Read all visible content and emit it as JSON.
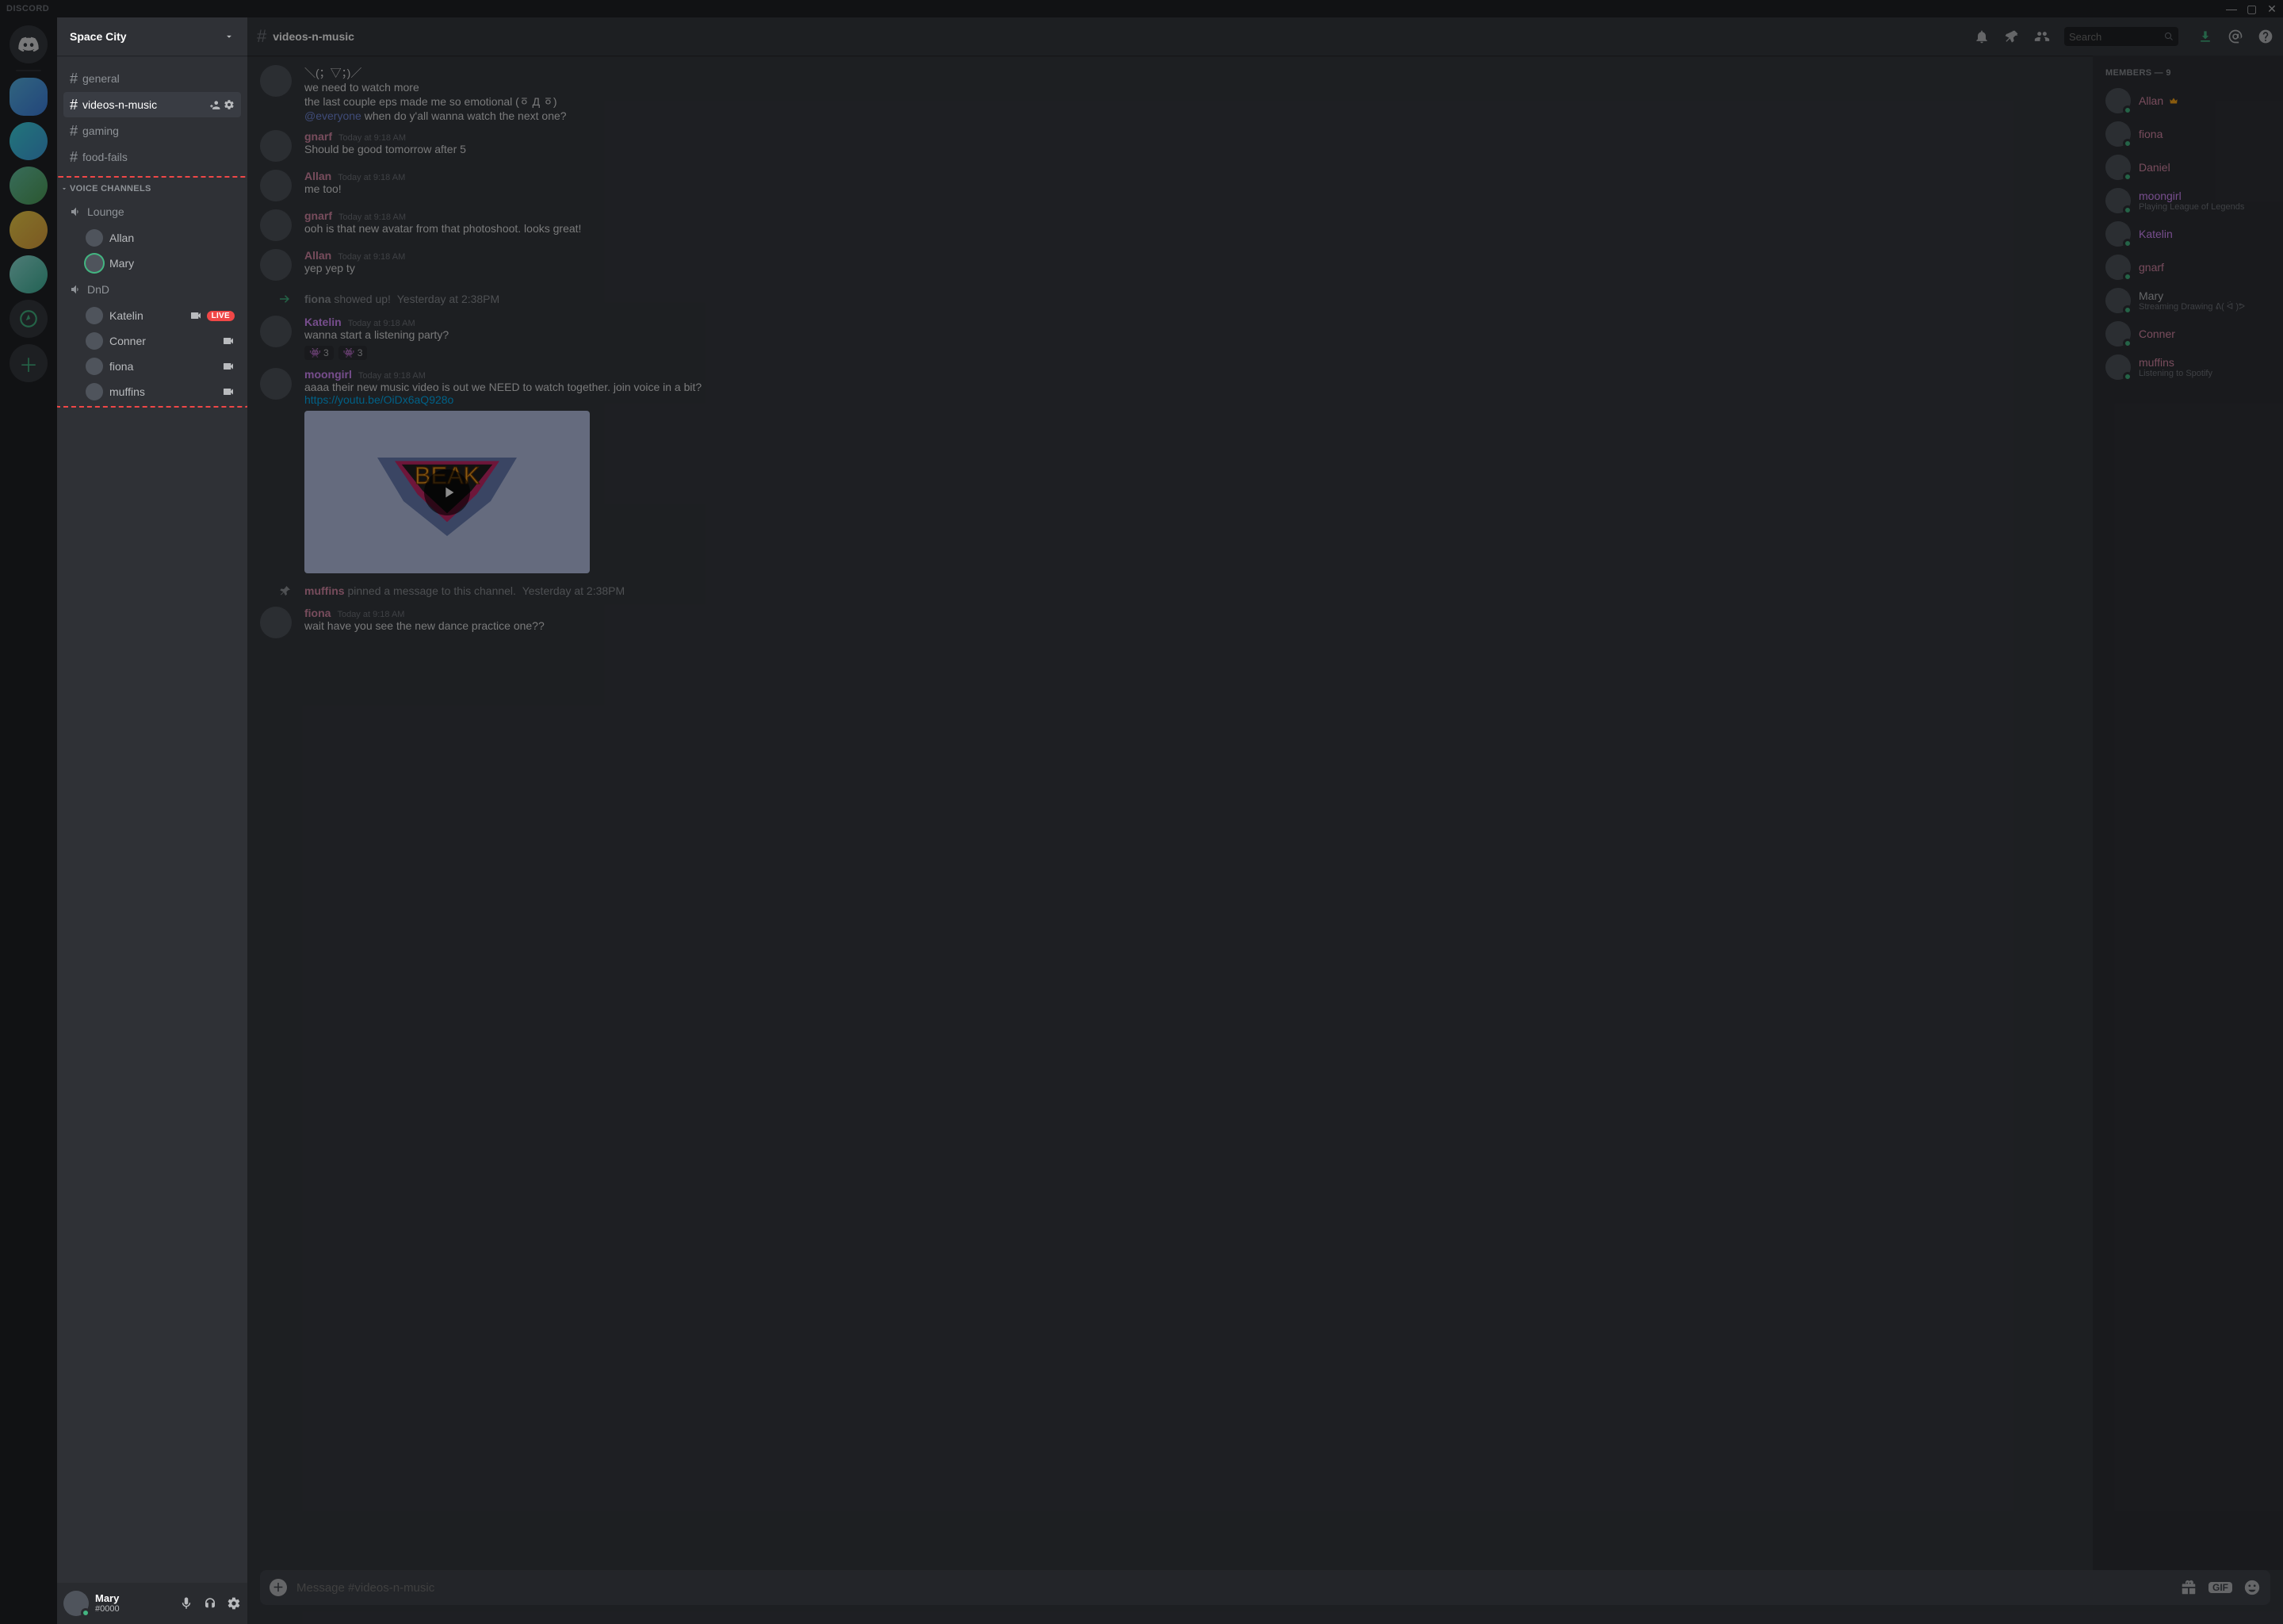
{
  "app": {
    "brand": "DISCORD"
  },
  "server": {
    "name": "Space City"
  },
  "textChannels": [
    {
      "name": "general",
      "active": false
    },
    {
      "name": "videos-n-music",
      "active": true
    },
    {
      "name": "gaming",
      "active": false
    },
    {
      "name": "food-fails",
      "active": false
    }
  ],
  "voiceSectionLabel": "VOICE CHANNELS",
  "voiceChannels": [
    {
      "name": "Lounge",
      "members": [
        {
          "name": "Allan",
          "speaking": false
        },
        {
          "name": "Mary",
          "speaking": true
        }
      ]
    },
    {
      "name": "DnD",
      "members": [
        {
          "name": "Katelin",
          "live": true,
          "video": true
        },
        {
          "name": "Conner",
          "video": true
        },
        {
          "name": "fiona",
          "video": true
        },
        {
          "name": "muffins",
          "video": true
        }
      ]
    }
  ],
  "liveBadge": "LIVE",
  "chatHeader": {
    "channel": "videos-n-music",
    "searchPlaceholder": "Search"
  },
  "messages": {
    "m0": {
      "lines": [
        "＼(；▽；)／",
        "we need to watch more",
        "the last couple eps made me so emotional   (ㆆ Д ㆆ)"
      ],
      "mention": "@everyone",
      "tail": " when do y'all wanna watch the next one?"
    },
    "m1": {
      "name": "gnarf",
      "ts": "Today at 9:18 AM",
      "text": "Should be good tomorrow after 5"
    },
    "m2": {
      "name": "Allan",
      "ts": "Today at 9:18 AM",
      "text": "me too!"
    },
    "m3": {
      "name": "gnarf",
      "ts": "Today at 9:18 AM",
      "text": "ooh is that new avatar from that photoshoot. looks great!"
    },
    "m4": {
      "name": "Allan",
      "ts": "Today at 9:18 AM",
      "text": "yep yep ty"
    },
    "sys1": {
      "name": "fiona",
      "tail": " showed up!",
      "ts": "Yesterday at 2:38PM"
    },
    "m5": {
      "name": "Katelin",
      "ts": "Today at 9:18 AM",
      "text": "wanna start a listening party?",
      "r1": "3",
      "r2": "3"
    },
    "m6": {
      "name": "moongirl",
      "ts": "Today at 9:18 AM",
      "text": "aaaa their new music video is out we NEED to watch together. join voice in a bit?",
      "link": "https://youtu.be/OiDx6aQ928o",
      "embedTitle": "BEAK"
    },
    "pin": {
      "name": "muffins",
      "tail": " pinned a message to this channel.",
      "ts": "Yesterday at 2:38PM"
    },
    "m7": {
      "name": "fiona",
      "ts": "Today at 9:18 AM",
      "text": "wait have you see the new dance practice one??"
    }
  },
  "composer": {
    "placeholder": "Message #videos-n-music"
  },
  "userDock": {
    "name": "Mary",
    "tag": "#0000"
  },
  "memberHeader": "MEMBERS — 9",
  "members": [
    {
      "name": "Allan",
      "cls": "name-allan",
      "owner": true
    },
    {
      "name": "fiona",
      "cls": "name-fiona"
    },
    {
      "name": "Daniel",
      "cls": "name-daniel"
    },
    {
      "name": "moongirl",
      "cls": "name-moongirl",
      "status": "Playing League of Legends"
    },
    {
      "name": "Katelin",
      "cls": "name-katelin"
    },
    {
      "name": "gnarf",
      "cls": "name-gnarf"
    },
    {
      "name": "Mary",
      "cls": "name-mary",
      "status": "Streaming Drawing ᕕ( ᐛ )ᕗ"
    },
    {
      "name": "Conner",
      "cls": "name-conner"
    },
    {
      "name": "muffins",
      "cls": "name-muffins",
      "status": "Listening to Spotify"
    }
  ]
}
